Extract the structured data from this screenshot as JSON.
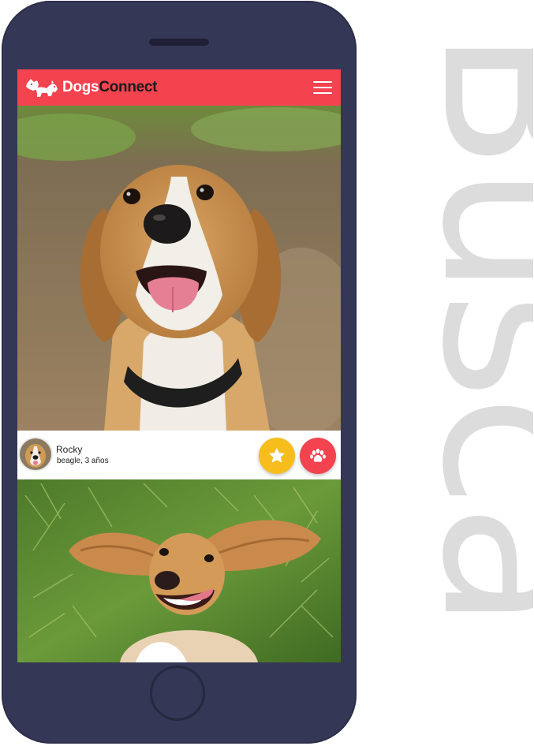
{
  "background_word": "Busca",
  "app": {
    "brand_part1": "Dogs",
    "brand_part2": "Connect",
    "brand_color": "#f2434f",
    "menu_icon": "hamburger-menu-icon"
  },
  "profile": {
    "name": "Rocky",
    "details": "beagle, 3 años"
  },
  "actions": {
    "favorite_icon": "star-icon",
    "favorite_color": "#f6bd1d",
    "like_icon": "paw-icon",
    "like_color": "#f2434f"
  },
  "phone_color": "#353756"
}
